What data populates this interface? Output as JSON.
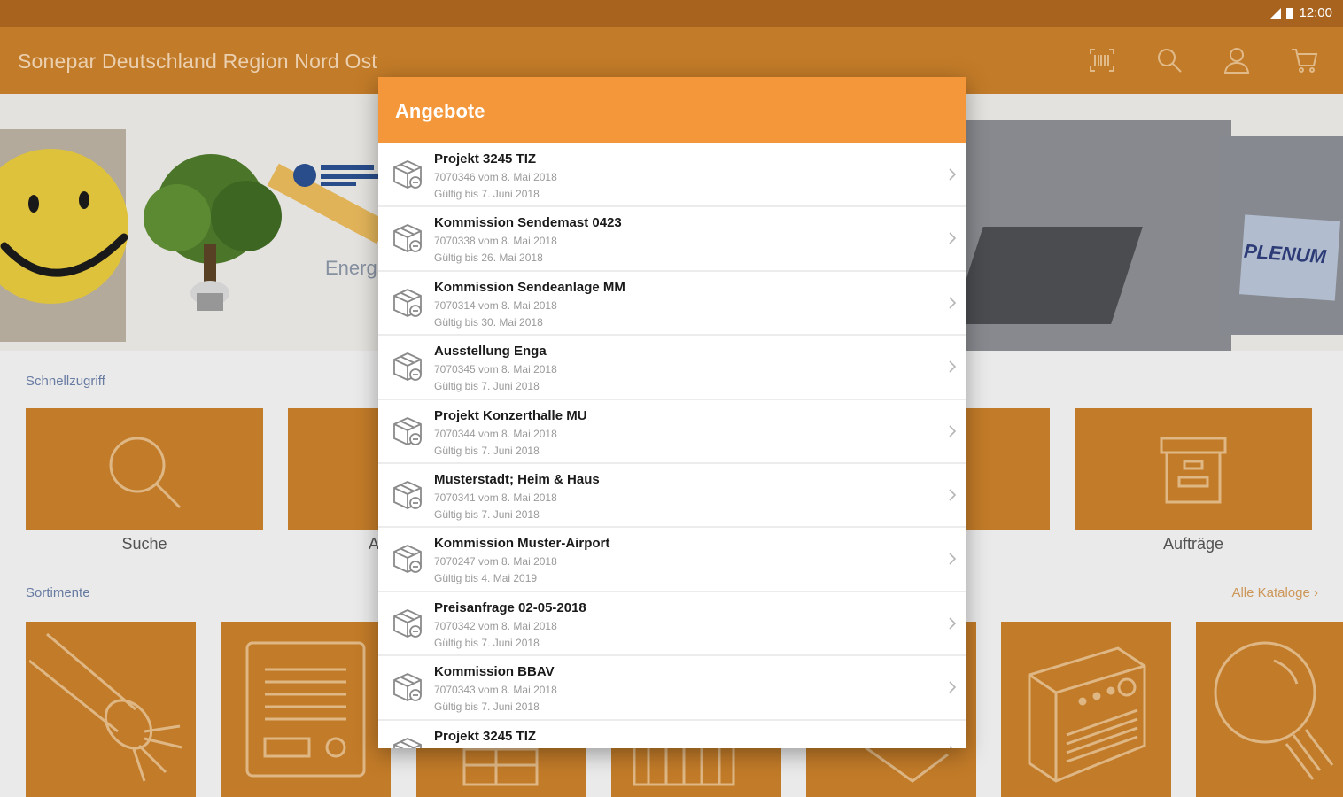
{
  "status_bar": {
    "time": "12:00"
  },
  "app_bar": {
    "title": "Sonepar Deutschland Region Nord Ost",
    "icons": [
      "barcode-scanner-icon",
      "search-icon",
      "user-icon",
      "cart-icon"
    ]
  },
  "banner": {
    "energy_label": "Energi",
    "plenum_label": "PLENUM"
  },
  "quick_access": {
    "label": "Schnellzugriff",
    "tiles": [
      {
        "label": "Suche",
        "icon": "search-icon"
      },
      {
        "label": "A",
        "icon": ""
      },
      {
        "label": "",
        "icon": ""
      },
      {
        "label": "Aufträge",
        "icon": "archive-box-icon"
      }
    ]
  },
  "assortments": {
    "label": "Sortimente",
    "all_link": "Alle Kataloge ›",
    "icons": [
      "cable-icon",
      "radiator-icon",
      "distribution-icon",
      "device-icon",
      "box-icon",
      "panel-icon",
      "bulb-icon"
    ]
  },
  "dialog": {
    "title": "Angebote",
    "items": [
      {
        "title": "Projekt 3245 TIZ",
        "line1": "7070346 vom 8. Mai 2018",
        "line2": "Gültig bis 7. Juni 2018"
      },
      {
        "title": "Kommission Sendemast 0423",
        "line1": "7070338 vom 8. Mai 2018",
        "line2": "Gültig bis 26. Mai 2018"
      },
      {
        "title": "Kommission Sendeanlage MM",
        "line1": "7070314 vom 8. Mai 2018",
        "line2": "Gültig bis 30. Mai 2018"
      },
      {
        "title": "Ausstellung Enga",
        "line1": "7070345 vom 8. Mai 2018",
        "line2": "Gültig bis 7. Juni 2018"
      },
      {
        "title": "Projekt Konzerthalle MU",
        "line1": "7070344 vom 8. Mai 2018",
        "line2": "Gültig bis 7. Juni 2018"
      },
      {
        "title": "Musterstadt; Heim & Haus",
        "line1": "7070341 vom 8. Mai 2018",
        "line2": "Gültig bis 7. Juni 2018"
      },
      {
        "title": "Kommission Muster-Airport",
        "line1": "7070247 vom 8. Mai 2018",
        "line2": "Gültig bis 4. Mai 2019"
      },
      {
        "title": "Preisanfrage 02-05-2018",
        "line1": "7070342 vom 8. Mai 2018",
        "line2": "Gültig bis 7. Juni 2018"
      },
      {
        "title": "Kommission BBAV",
        "line1": "7070343 vom 8. Mai 2018",
        "line2": "Gültig bis 7. Juni 2018"
      },
      {
        "title": "Projekt 3245 TIZ",
        "line1": "",
        "line2": ""
      }
    ]
  }
}
